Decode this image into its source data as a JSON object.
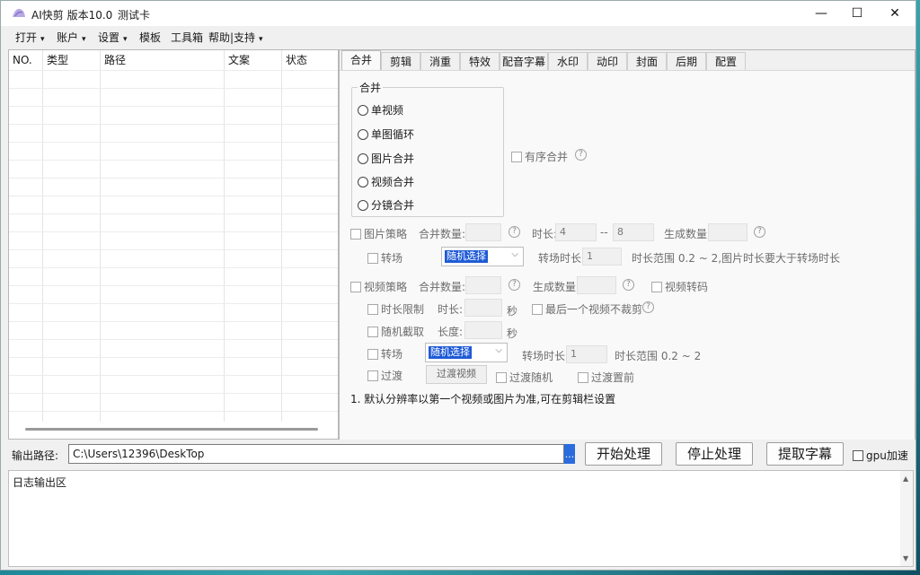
{
  "titlebar": {
    "title": "AI快剪  版本10.0",
    "card": "测试卡",
    "minimize": "—",
    "maximize": "☐",
    "close": "✕"
  },
  "menu": [
    {
      "label": "打开",
      "caret": "▾"
    },
    {
      "label": "账户",
      "caret": "▾"
    },
    {
      "label": "设置",
      "caret": "▾"
    },
    {
      "label": "模板",
      "caret": ""
    },
    {
      "label": "工具箱",
      "caret": ""
    },
    {
      "label": "帮助|支持",
      "caret": "▾"
    }
  ],
  "list": {
    "columns": [
      "NO.",
      "类型",
      "路径",
      "文案",
      "状态"
    ]
  },
  "tabs": [
    "合并",
    "剪辑",
    "消重",
    "特效",
    "配音字幕",
    "水印",
    "动印",
    "封面",
    "后期",
    "配置"
  ],
  "merge": {
    "group_title": "合并",
    "options": [
      "单视频",
      "单图循环",
      "图片合并",
      "视频合并",
      "分镜合并"
    ],
    "ordered_merge": "有序合并",
    "help": "?",
    "image": {
      "strategy": "图片策略",
      "count_label": "合并数量:",
      "duration_label": "时长:",
      "duration_min": "4",
      "dash": "--",
      "duration_max": "8",
      "gen_count_label": "生成数量:",
      "transition": "转场",
      "transition_select": "随机选择",
      "transition_duration_label": "转场时长:",
      "transition_duration": "1",
      "range_note": "时长范围 0.2 ~ 2,图片时长要大于转场时长"
    },
    "video": {
      "strategy": "视频策略",
      "count_label": "合并数量:",
      "gen_count_label": "生成数量:",
      "transcode": "视频转码",
      "limit": "时长限制",
      "duration_label": "时长:",
      "seconds": "秒",
      "no_cut_last": "最后一个视频不裁剪",
      "random_cut": "随机截取",
      "length_label": "长度:",
      "transition": "转场",
      "transition_select": "随机选择",
      "transition_duration_label": "转场时长:",
      "transition_duration": "1",
      "range_note": "时长范围 0.2 ~ 2",
      "fade": "过渡",
      "fade_video": "过渡视频",
      "fade_random": "过渡随机",
      "fade_front": "过渡置前"
    },
    "note": "1. 默认分辨率以第一个视频或图片为准,可在剪辑栏设置"
  },
  "output": {
    "label": "输出路径:",
    "path": "C:\\Users\\12396\\DeskTop",
    "browse": "...",
    "start": "开始处理",
    "stop": "停止处理",
    "extract": "提取字幕",
    "gpu": "gpu加速"
  },
  "log": {
    "title": "日志输出区"
  }
}
